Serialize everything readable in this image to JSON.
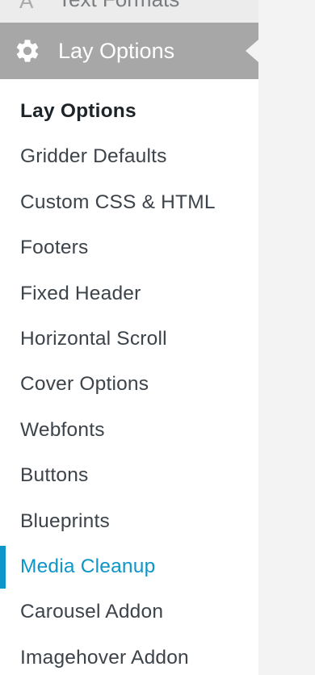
{
  "menu_prev": {
    "icon": "text-formats-icon",
    "label": "Text Formats"
  },
  "menu_top": {
    "icon": "gear-icon",
    "label": "Lay Options"
  },
  "submenu": [
    {
      "label": "Lay Options",
      "state": "current"
    },
    {
      "label": "Gridder Defaults"
    },
    {
      "label": "Custom CSS & HTML"
    },
    {
      "label": "Footers"
    },
    {
      "label": "Fixed Header"
    },
    {
      "label": "Horizontal Scroll"
    },
    {
      "label": "Cover Options"
    },
    {
      "label": "Webfonts"
    },
    {
      "label": "Buttons"
    },
    {
      "label": "Blueprints"
    },
    {
      "label": "Media Cleanup",
      "state": "active"
    },
    {
      "label": "Carousel Addon"
    },
    {
      "label": "Imagehover Addon"
    }
  ],
  "colors": {
    "menu_top_bg": "#a7a7a7",
    "active_text": "#0e95c9",
    "active_bar": "#0e95c9",
    "text": "#3c434a",
    "current_text": "#1d2327"
  }
}
